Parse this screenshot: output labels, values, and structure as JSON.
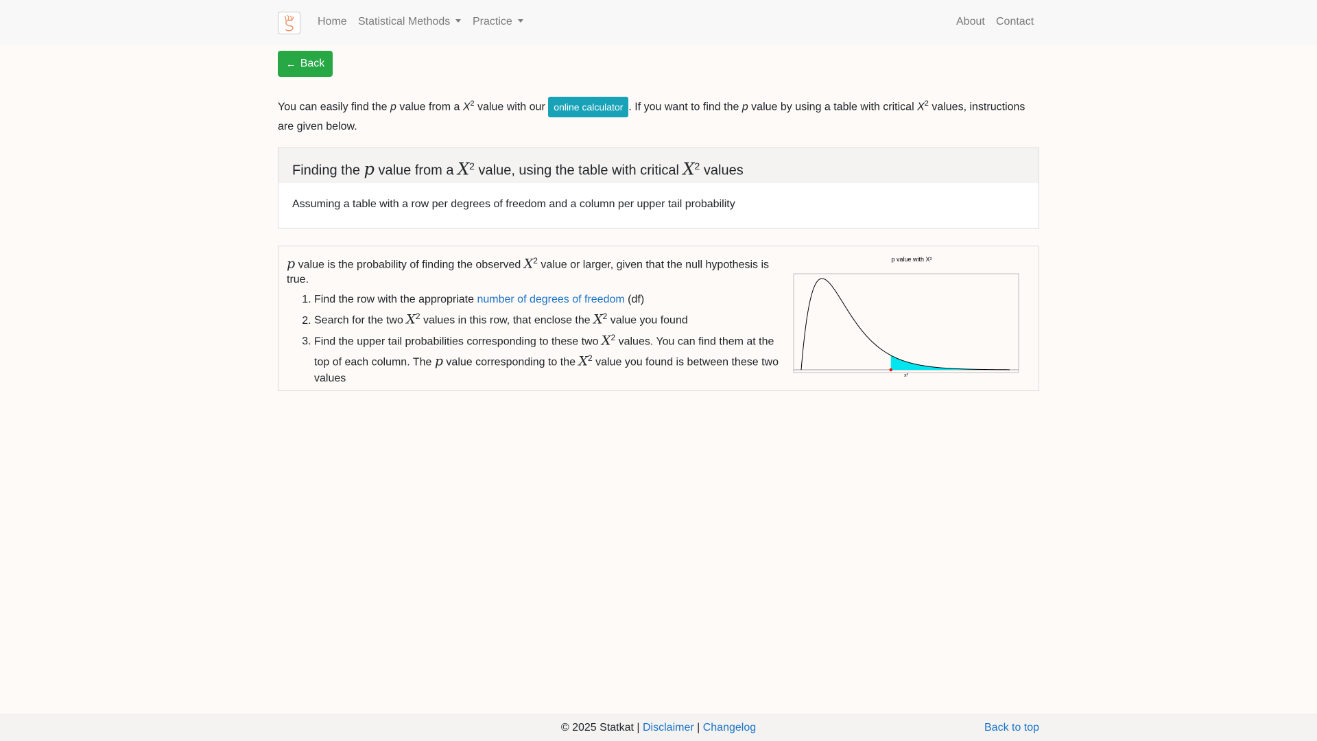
{
  "nav": {
    "home": "Home",
    "methods": "Statistical Methods",
    "practice": "Practice",
    "about": "About",
    "contact": "Contact"
  },
  "back_button": "Back",
  "intro": {
    "part1": "You can easily find the ",
    "p": "p",
    "part2": " value from a ",
    "x": "X",
    "sq": "2",
    "part3": " value with our ",
    "calc_button": "online calculator",
    "part4": ". If you want to find the ",
    "part5": " value by using a table with critical ",
    "part6": " values, instructions are given below."
  },
  "card": {
    "head_part1": "Finding the ",
    "head_part2": " value from a ",
    "head_part3": " value, using the table with critical ",
    "head_part4": " values",
    "body": "Assuming a table with a row per degrees of freedom and a column per upper tail probability"
  },
  "panel": {
    "intro_part1": " value is the probability of finding the observed ",
    "intro_part2": " value or larger, given that the null hypothesis is true.",
    "step1_a": "Find the row with the appropriate ",
    "step1_link": "number of degrees of freedom",
    "step1_b": " (df)",
    "step2_a": "Search for the two ",
    "step2_b": " values in this row, that enclose the ",
    "step2_c": " value you found",
    "step3_a": "Find the upper tail probabilities corresponding to these two ",
    "step3_b": " values. You can find them at the top of each column. The ",
    "step3_c": " value corresponding to the ",
    "step3_d": " value you found is between these two values"
  },
  "chart_data": {
    "type": "area",
    "title": "p value with X²",
    "xlabel": "x²",
    "ylabel": "",
    "distribution": "chi-square",
    "df": 4,
    "xlim": [
      0,
      20
    ],
    "observed_x2": 8.6,
    "shaded_region": "upper tail (x² ≥ observed)",
    "colors": {
      "curve": "#000000",
      "shade": "#00e5ee",
      "marker": "#ff0000"
    }
  },
  "footer": {
    "copyright": "© 2025 Statkat | ",
    "disclaimer": "Disclaimer",
    "sep": " | ",
    "changelog": "Changelog",
    "back_to_top": "Back to top"
  }
}
